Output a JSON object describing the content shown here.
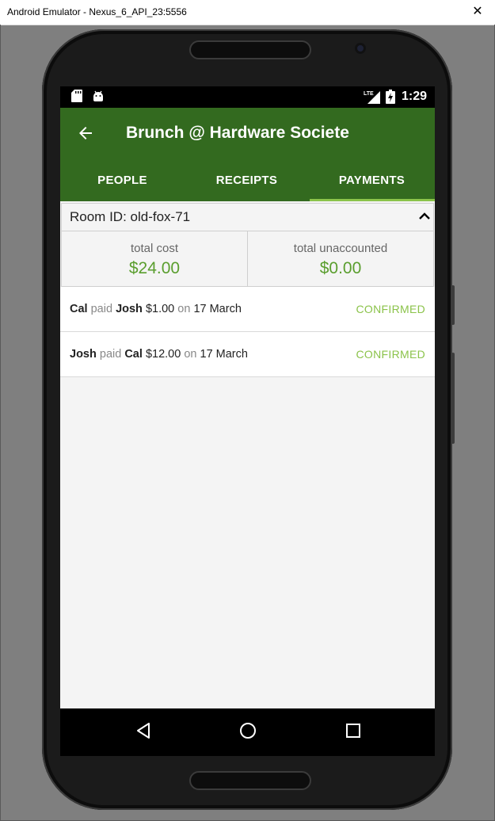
{
  "window": {
    "title": "Android Emulator - Nexus_6_API_23:5556",
    "close_glyph": "✕"
  },
  "statusbar": {
    "icons": [
      "sd-card-icon",
      "android-debug-icon",
      "lte-signal-icon",
      "battery-charging-icon"
    ],
    "time": "1:29"
  },
  "appbar": {
    "title": "Brunch @ Hardware Societe",
    "back_icon": "arrow-back-icon",
    "background": "#336a1f"
  },
  "tabs": [
    {
      "label": "PEOPLE",
      "selected": false
    },
    {
      "label": "RECEIPTS",
      "selected": false
    },
    {
      "label": "PAYMENTS",
      "selected": true
    }
  ],
  "room": {
    "label": "Room ID: old-fox-71",
    "toggle_icon": "chevron-up-icon"
  },
  "stats": {
    "total_cost": {
      "label": "total cost",
      "value": "$24.00"
    },
    "total_unaccounted": {
      "label": "total unaccounted",
      "value": "$0.00"
    }
  },
  "payments": [
    {
      "payer": "Cal",
      "verb": "paid",
      "payee": "Josh",
      "amount": "$1.00",
      "on": "on",
      "date": "17 March",
      "status": "CONFIRMED"
    },
    {
      "payer": "Josh",
      "verb": "paid",
      "payee": "Cal",
      "amount": "$12.00",
      "on": "on",
      "date": "17 March",
      "status": "CONFIRMED"
    }
  ],
  "navbar": {
    "icons": [
      "nav-back-icon",
      "nav-home-icon",
      "nav-recents-icon"
    ]
  },
  "colors": {
    "accent": "#8bc34a",
    "money": "#5a9e2e",
    "primary": "#336a1f"
  }
}
